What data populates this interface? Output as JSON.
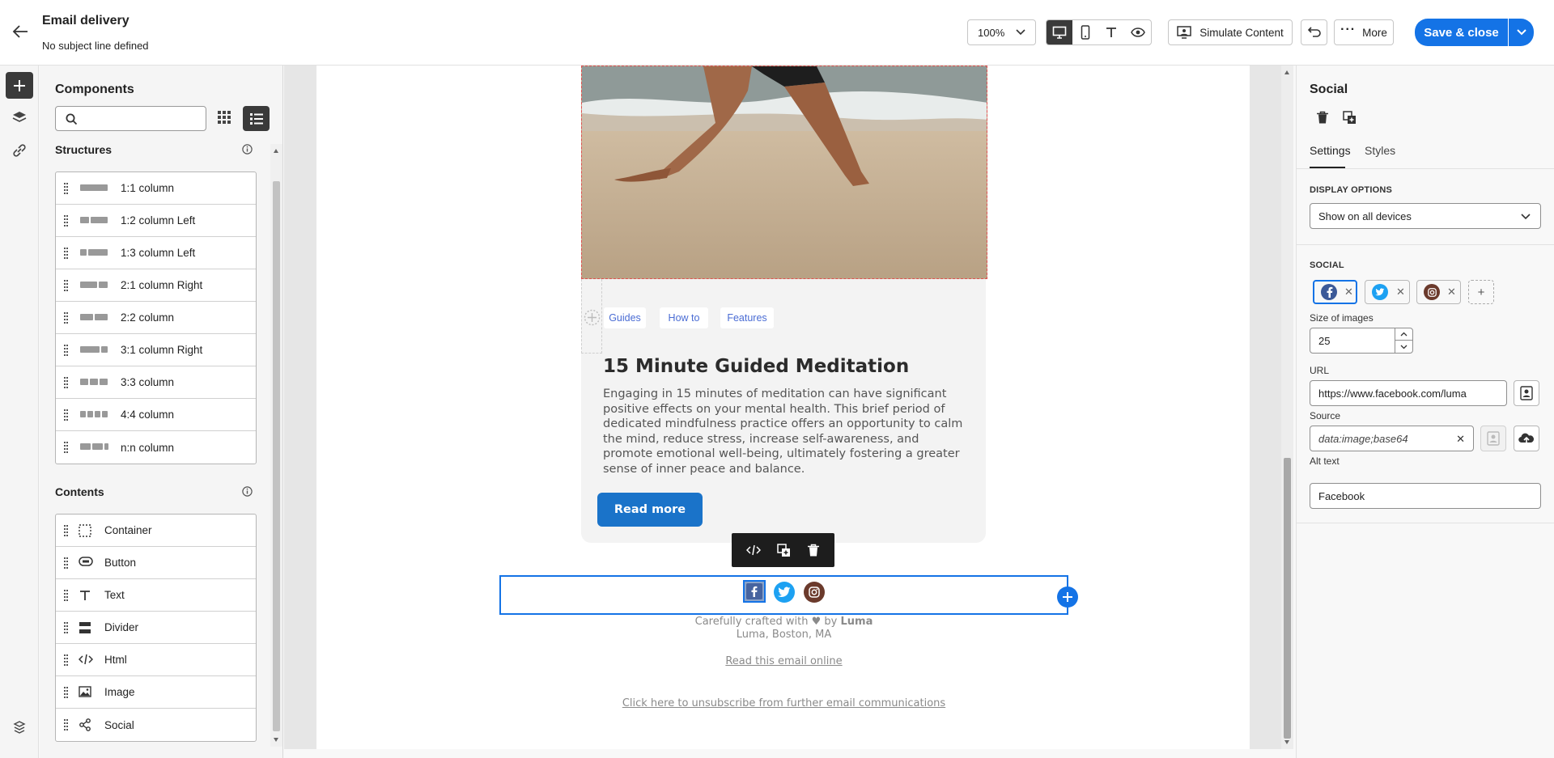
{
  "header": {
    "title": "Email delivery",
    "subtitle": "No subject line defined",
    "zoom": "100%",
    "simulate_label": "Simulate Content",
    "more_label": "More",
    "save_label": "Save & close"
  },
  "left_panel": {
    "title": "Components",
    "search": {
      "value": "",
      "placeholder": ""
    },
    "structures_title": "Structures",
    "structures": [
      {
        "label": "1:1 column",
        "cols": [
          1
        ]
      },
      {
        "label": "1:2 column Left",
        "cols": [
          1,
          2
        ]
      },
      {
        "label": "1:3 column Left",
        "cols": [
          1,
          3
        ]
      },
      {
        "label": "2:1 column Right",
        "cols": [
          2,
          1
        ]
      },
      {
        "label": "2:2 column",
        "cols": [
          2,
          2
        ]
      },
      {
        "label": "3:1 column Right",
        "cols": [
          3,
          1
        ]
      },
      {
        "label": "3:3 column",
        "cols": [
          1,
          1,
          1
        ]
      },
      {
        "label": "4:4 column",
        "cols": [
          1,
          1,
          1,
          1
        ]
      },
      {
        "label": "n:n column",
        "cols": [
          1,
          1,
          0.4
        ]
      }
    ],
    "contents_title": "Contents",
    "contents": [
      {
        "label": "Container",
        "icon": "container-icon"
      },
      {
        "label": "Button",
        "icon": "button-icon"
      },
      {
        "label": "Text",
        "icon": "text-icon"
      },
      {
        "label": "Divider",
        "icon": "divider-icon"
      },
      {
        "label": "Html",
        "icon": "html-icon"
      },
      {
        "label": "Image",
        "icon": "image-icon"
      },
      {
        "label": "Social",
        "icon": "social-icon"
      }
    ]
  },
  "email": {
    "tags": [
      "Guides",
      "How to",
      "Features"
    ],
    "article_title": "15 Minute Guided Meditation",
    "article_lines": [
      "Engaging in 15 minutes of meditation can have significant",
      "positive effects on your mental health. This brief period of",
      "dedicated mindfulness practice offers an opportunity to calm",
      "the mind, reduce stress, increase self-awareness, and",
      "promote emotional well-being, ultimately fostering a greater",
      "sense of inner peace and balance."
    ],
    "read_more_label": "Read more",
    "footer_crafted": "Carefully crafted with ♥ by",
    "footer_brand": "Luma",
    "footer_address": "Luma, Boston, MA",
    "read_online": "Read this email online",
    "unsubscribe": "Click here to unsubscribe from further email communications"
  },
  "right_panel": {
    "title": "Social",
    "tabs": [
      "Settings",
      "Styles"
    ],
    "display_options_caption": "DISPLAY OPTIONS",
    "display_option_value": "Show on all devices",
    "social_caption": "SOCIAL",
    "size_label": "Size of images",
    "size_value": "25",
    "url_label": "URL",
    "url_value": "https://www.facebook.com/luma",
    "source_label": "Source",
    "source_value": "data:image;base64",
    "alt_label": "Alt text",
    "alt_value": "Facebook"
  },
  "colors": {
    "accent": "#1473e6",
    "facebook": "#3b5998",
    "twitter": "#1da1f2",
    "instagram": "#6b3a2c",
    "read_more_bg": "#1a73c9"
  }
}
